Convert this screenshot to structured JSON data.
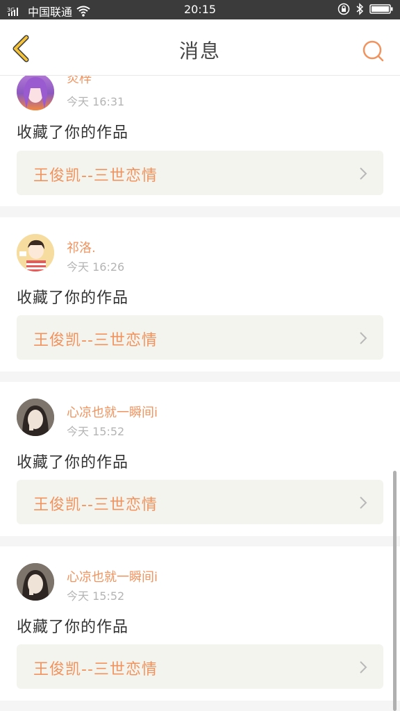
{
  "status_bar": {
    "carrier": "中国联通",
    "time": "20:15"
  },
  "header": {
    "title": "消息"
  },
  "messages": [
    {
      "user": "炎梓",
      "time": "今天 16:31",
      "action": "收藏了你的作品",
      "work_title": "王俊凯--三世恋情"
    },
    {
      "user": "祁洛.",
      "time": "今天 16:26",
      "action": "收藏了你的作品",
      "work_title": "王俊凯--三世恋情"
    },
    {
      "user": "心凉也就一瞬间i",
      "time": "今天 15:52",
      "action": "收藏了你的作品",
      "work_title": "王俊凯--三世恋情"
    },
    {
      "user": "心凉也就一瞬间i",
      "time": "今天 15:52",
      "action": "收藏了你的作品",
      "work_title": "王俊凯--三世恋情"
    }
  ],
  "colors": {
    "accent": "#f0935e",
    "back_arrow": "#f5c33b",
    "status_bar": "#3b3b3b"
  }
}
